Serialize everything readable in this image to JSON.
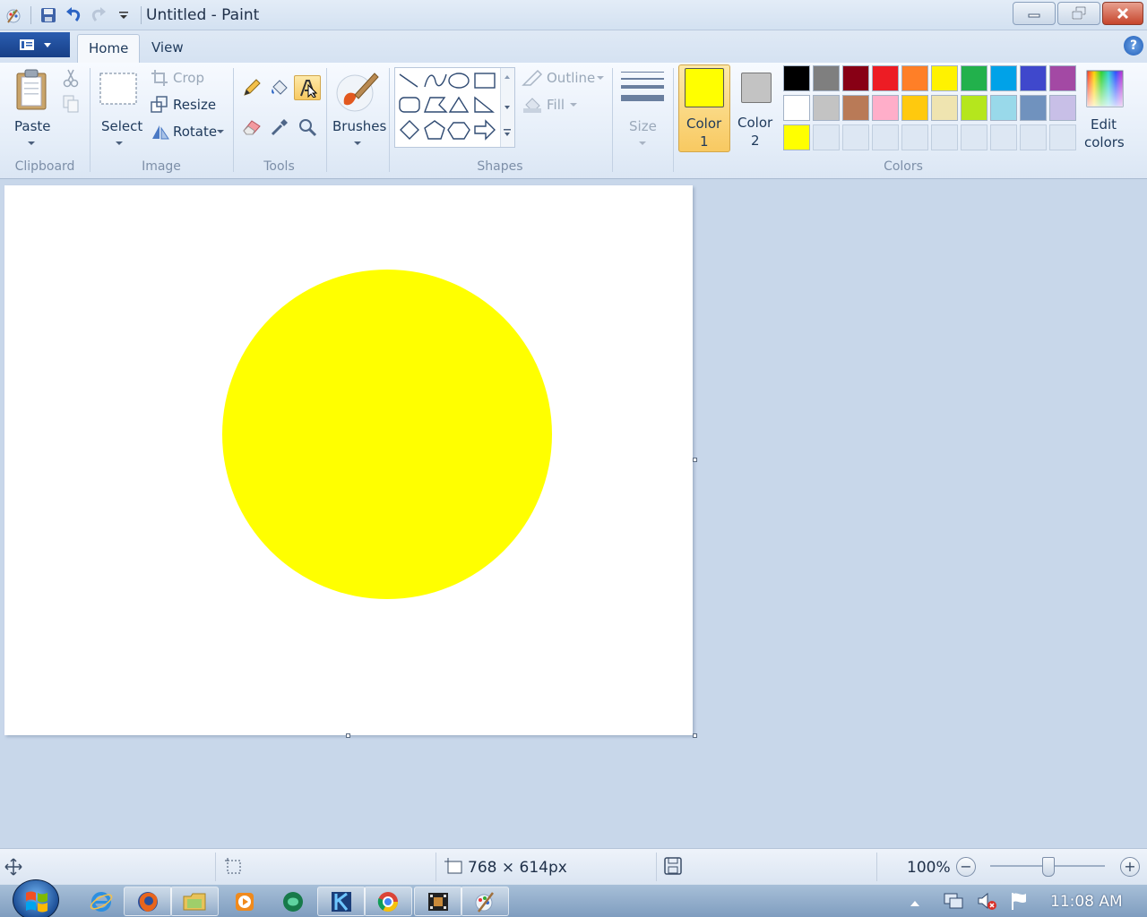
{
  "window": {
    "title": "Untitled - Paint"
  },
  "ribbon": {
    "tabs": [
      {
        "label": "Home",
        "active": true
      },
      {
        "label": "View",
        "active": false
      }
    ],
    "groups": {
      "clipboard": {
        "label": "Clipboard",
        "paste": "Paste"
      },
      "image": {
        "label": "Image",
        "select": "Select",
        "crop": "Crop",
        "resize": "Resize",
        "rotate": "Rotate"
      },
      "tools": {
        "label": "Tools"
      },
      "brushes": {
        "label": "Brushes"
      },
      "shapes": {
        "label": "Shapes",
        "outline": "Outline",
        "fill": "Fill"
      },
      "size": {
        "label": "Size"
      },
      "colors": {
        "label": "Colors",
        "color1_line1": "Color",
        "color1_line2": "1",
        "color2_line1": "Color",
        "color2_line2": "2",
        "edit_line1": "Edit",
        "edit_line2": "colors",
        "color1_value": "#ffff00",
        "color2_value": "#c3c3c3",
        "palette_row1": [
          "#000000",
          "#7f7f7f",
          "#880015",
          "#ed1c24",
          "#ff7f27",
          "#fff200",
          "#22b14c",
          "#00a2e8",
          "#3f48cc",
          "#a349a4"
        ],
        "palette_row2": [
          "#ffffff",
          "#c3c3c3",
          "#b97a57",
          "#ffaec9",
          "#ffc90e",
          "#efe4b0",
          "#b5e61d",
          "#99d9ea",
          "#7092be",
          "#c8bfe7"
        ],
        "custom_row": [
          "#ffff00"
        ]
      }
    }
  },
  "canvas": {
    "background": "#ffffff",
    "shape_fill": "#ffff00"
  },
  "statusbar": {
    "dimensions": "768 × 614px",
    "zoom": "100%"
  },
  "taskbar": {
    "clock": "11:08 AM"
  }
}
